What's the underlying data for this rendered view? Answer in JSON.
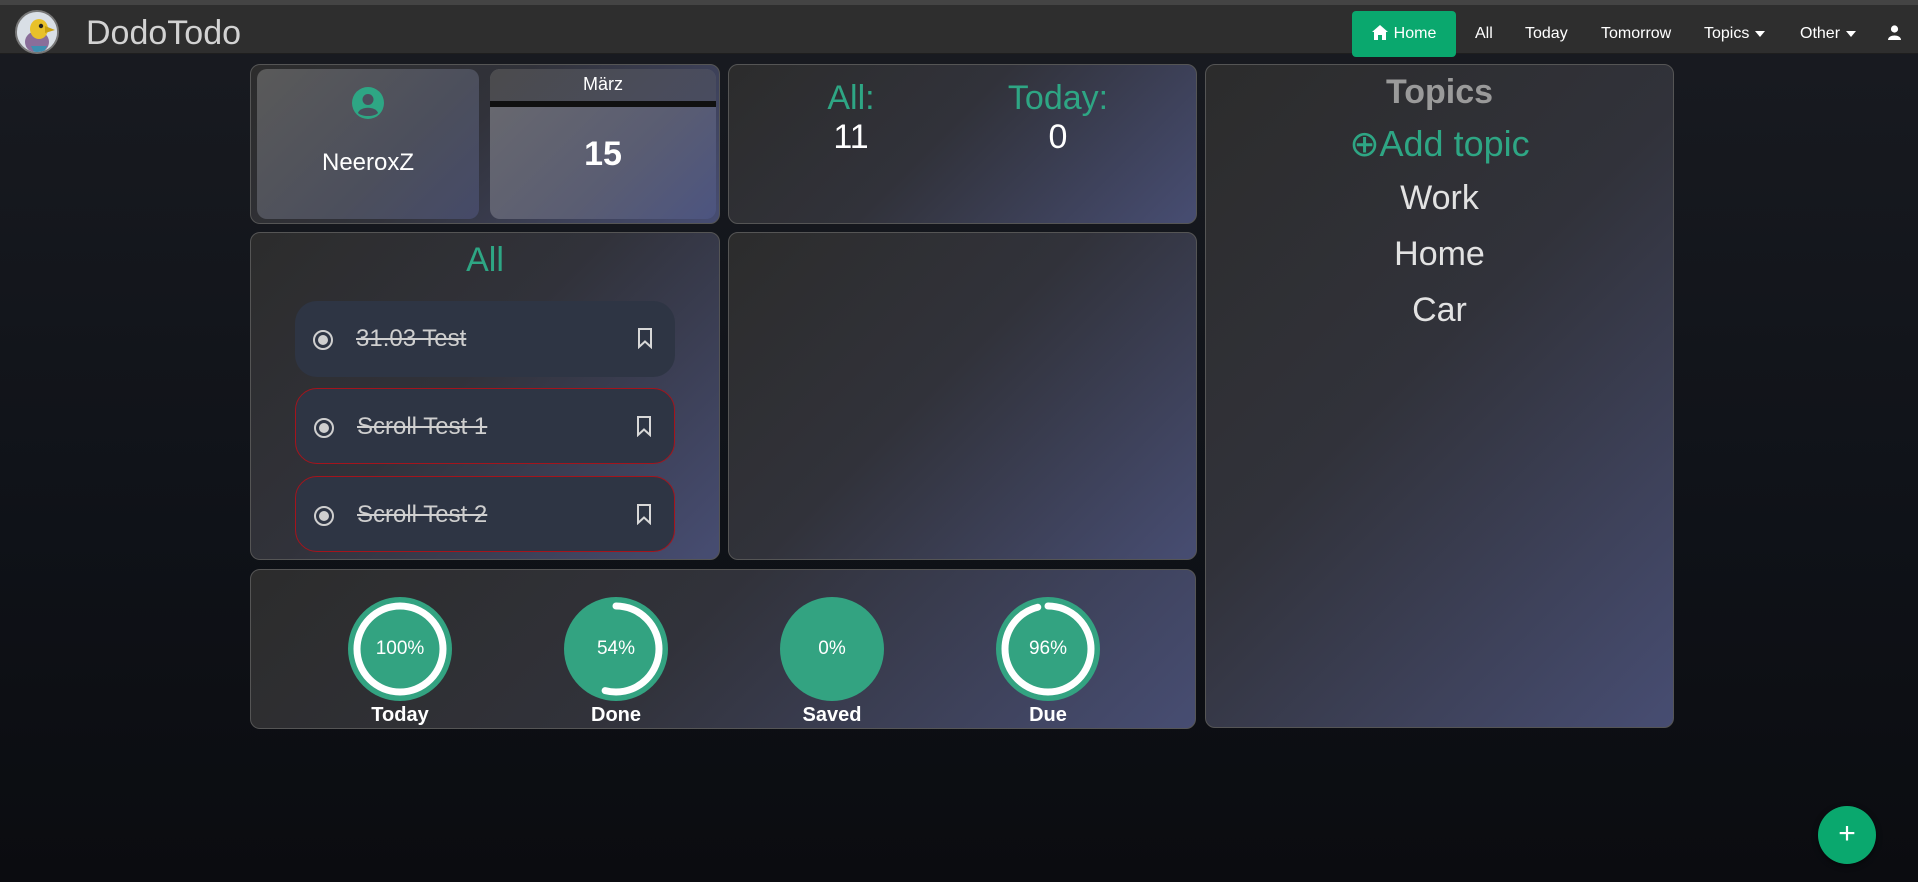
{
  "app": {
    "title": "DodoTodo"
  },
  "nav": {
    "home": "Home",
    "all": "All",
    "today": "Today",
    "tomorrow": "Tomorrow",
    "topics": "Topics",
    "other": "Other"
  },
  "profile": {
    "username": "NeeroxZ"
  },
  "calendar": {
    "month": "März",
    "day": "15"
  },
  "counts": {
    "all_label": "All:",
    "all_value": "11",
    "today_label": "Today:",
    "today_value": "0"
  },
  "topics": {
    "title": "Topics",
    "add_label": "⊕Add topic",
    "items": [
      "Work",
      "Home",
      "Car"
    ]
  },
  "all_list": {
    "title": "All",
    "tasks": [
      {
        "text": "31.03 Test",
        "done": true,
        "overdue": false
      },
      {
        "text": "Scroll Test 1",
        "done": true,
        "overdue": true
      },
      {
        "text": "Scroll Test 2",
        "done": true,
        "overdue": true
      }
    ]
  },
  "stats": [
    {
      "label": "Today",
      "percent": 100,
      "text": "100%"
    },
    {
      "label": "Done",
      "percent": 54,
      "text": "54%"
    },
    {
      "label": "Saved",
      "percent": 0,
      "text": "0%"
    },
    {
      "label": "Due",
      "percent": 96,
      "text": "96%"
    }
  ],
  "colors": {
    "accent": "#0aa86e",
    "teal": "#2ea684",
    "ring_fill": "#33a381",
    "overdue_border": "#a4141c"
  },
  "fab": {
    "label": "+"
  }
}
